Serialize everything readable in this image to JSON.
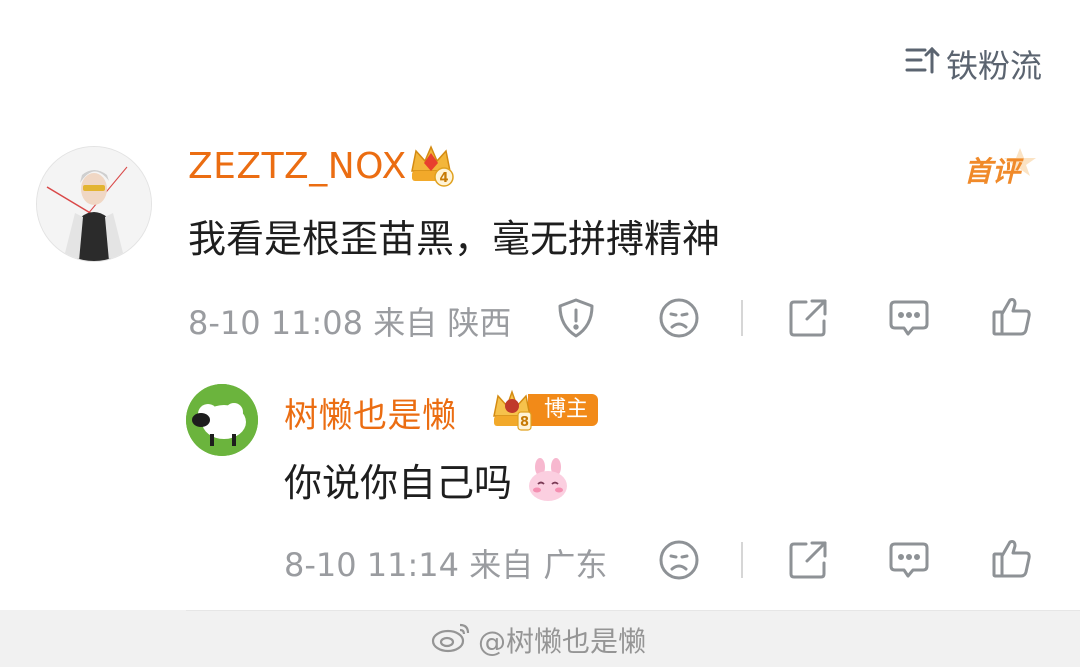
{
  "header": {
    "sort_label": "铁粉流"
  },
  "comment": {
    "username": "ZEZTZ_NOX",
    "fan_level": "4",
    "first_badge": "首评",
    "text": "我看是根歪苗黑，毫无拼搏精神",
    "time": "8-10 11:08",
    "from_label": "来自",
    "location": "陕西"
  },
  "reply": {
    "username": "树懒也是懒",
    "fan_level": "8",
    "role_badge": "博主",
    "text": "你说你自己吗",
    "emoji": "bunny-blush-emoji",
    "time": "8-10 11:14",
    "from_label": "来自",
    "location": "广东"
  },
  "icons": {
    "sort": "sort-up-icon",
    "report": "shield-exclamation-icon",
    "dislike": "frown-face-icon",
    "share": "share-icon",
    "comment": "comment-icon",
    "like": "thumbs-up-icon"
  },
  "footer": {
    "watermark": "@树懒也是懒"
  },
  "colors": {
    "username": "#eb6d12",
    "meta": "#9a9ca0",
    "badge": "#f28a18"
  }
}
